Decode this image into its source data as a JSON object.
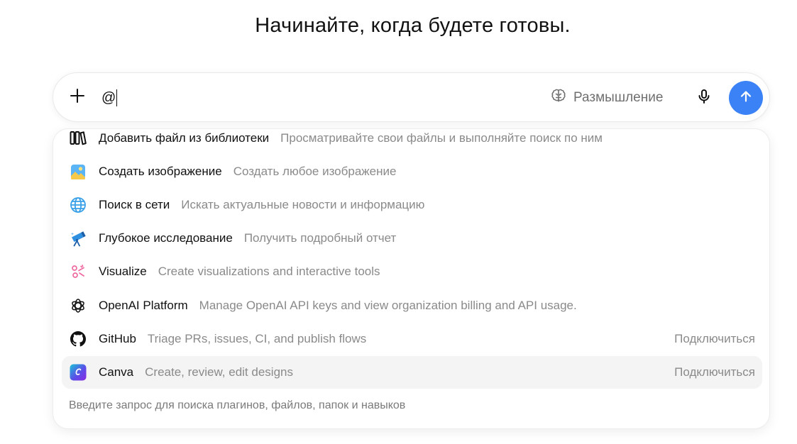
{
  "headline": "Начинайте, когда будете готовы.",
  "composer": {
    "input_value": "@",
    "thinking_label": "Размышление",
    "icons": {
      "plus": "plus-icon",
      "thinking": "brain-icon",
      "mic": "microphone-icon",
      "send": "arrow-up-icon"
    },
    "send_color": "#3b82f6"
  },
  "menu": {
    "items": [
      {
        "label": "Добавить файл из библиотеки",
        "description": "Просматривайте свои файлы и выполняйте поиск по ним",
        "icon": "library-icon"
      },
      {
        "label": "Создать изображение",
        "description": "Создать любое изображение",
        "icon": "image-icon"
      },
      {
        "label": "Поиск в сети",
        "description": "Искать актуальные новости и информацию",
        "icon": "globe-icon"
      },
      {
        "label": "Глубокое исследование",
        "description": "Получить подробный отчет",
        "icon": "telescope-icon"
      },
      {
        "label": "Visualize",
        "description": "Create visualizations and interactive tools",
        "icon": "visualize-icon"
      },
      {
        "label": "OpenAI Platform",
        "description": "Manage OpenAI API keys and view organization billing and API usage.",
        "icon": "openai-icon"
      },
      {
        "label": "GitHub",
        "description": "Triage PRs, issues, CI, and publish flows",
        "icon": "github-icon",
        "action": "Подключиться"
      },
      {
        "label": "Canva",
        "description": "Create, review, edit designs",
        "icon": "canva-icon",
        "action": "Подключиться"
      }
    ],
    "footer_hint": "Введите запрос для поиска плагинов, файлов, папок и навыков"
  }
}
